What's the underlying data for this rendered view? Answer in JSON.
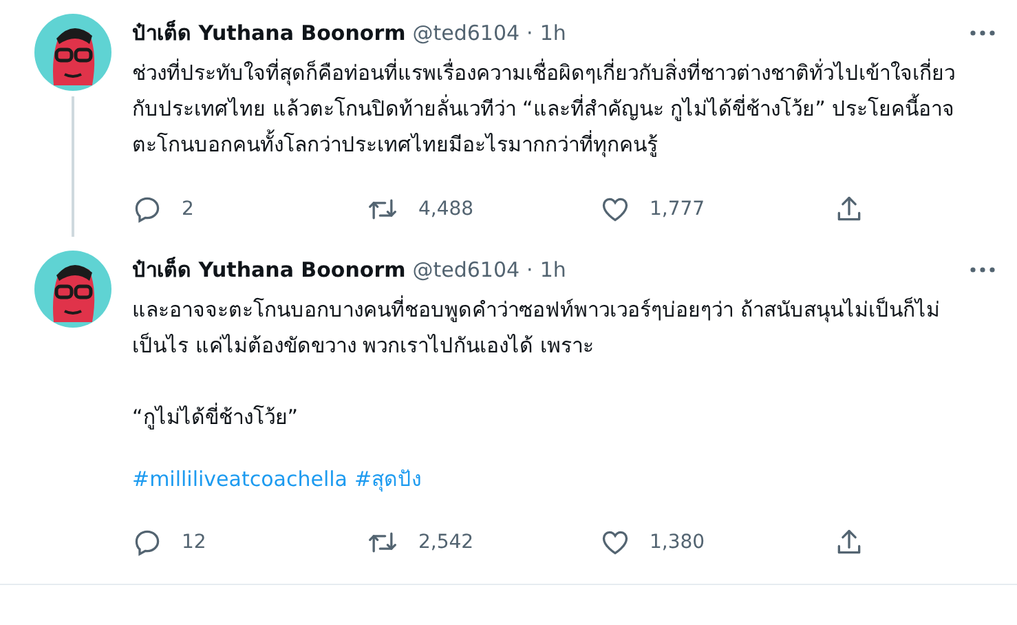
{
  "tweets": [
    {
      "name": "ป๋าเต็ด Yuthana Boonorm",
      "handle": "@ted6104",
      "separator": "·",
      "time": "1h",
      "thread_line": true,
      "paragraphs": [
        "ช่วงที่ประทับใจที่สุดก็คือท่อนที่แรพเรื่องความเชื่อผิดๆเกี่ยวกับสิ่งที่ชาวต่างชาติทั่วไปเข้าใจเกี่ยวกับประเทศไทย แล้วตะโกนปิดท้ายลั่นเวทีว่า “และที่สำคัญนะ กูไม่ได้ขี่ช้างโว้ย” ประโยคนี้อาจตะโกนบอกคนทั้งโลกว่าประเทศไทยมีอะไรมากกว่าที่ทุกคนรู้"
      ],
      "replies": "2",
      "retweets": "4,488",
      "likes": "1,777"
    },
    {
      "name": "ป๋าเต็ด Yuthana Boonorm",
      "handle": "@ted6104",
      "separator": "·",
      "time": "1h",
      "thread_line": false,
      "paragraphs": [
        "และอาจจะตะโกนบอกบางคนที่ชอบพูดคำว่าซอฟท์พาวเวอร์ๆบ่อยๆว่า ถ้าสนับสนุนไม่เป็นก็ไม่เป็นไร แค่ไม่ต้องขัดขวาง พวกเราไปกันเองได้ เพราะ",
        "“กูไม่ได้ขี่ช้างโว้ย”"
      ],
      "hashtags": [
        "#milliliveatcoachella",
        "#สุดปัง"
      ],
      "replies": "12",
      "retweets": "2,542",
      "likes": "1,380"
    }
  ]
}
